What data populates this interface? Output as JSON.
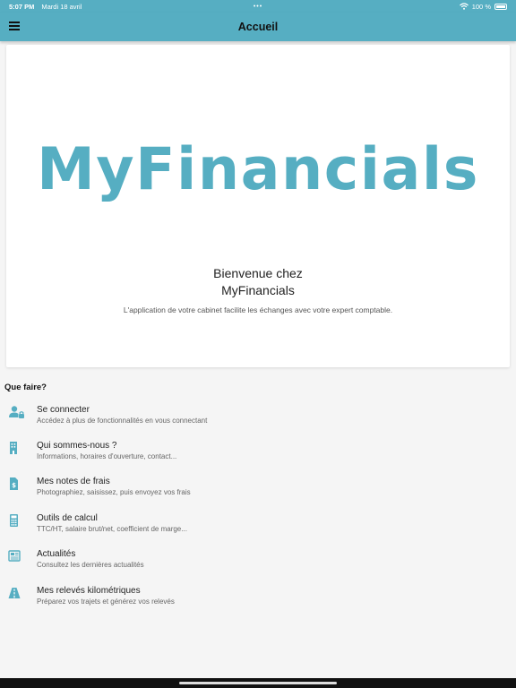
{
  "statusbar": {
    "time": "5:07 PM",
    "date": "Mardi 18 avril",
    "dots": "•••",
    "battery": "100 %"
  },
  "header": {
    "title": "Accueil"
  },
  "card": {
    "logo": "MyFinancials",
    "welcome_line1": "Bienvenue chez",
    "welcome_line2": "MyFinancials",
    "tagline": "L'application de votre cabinet facilite les échanges avec votre expert comptable."
  },
  "section": {
    "title": "Que faire?"
  },
  "items": [
    {
      "title": "Se connecter",
      "subtitle": "Accédez à plus de fonctionnalités en vous connectant",
      "icon": "user-lock-icon"
    },
    {
      "title": "Qui sommes-nous ?",
      "subtitle": "Informations, horaires d'ouverture, contact...",
      "icon": "building-icon"
    },
    {
      "title": "Mes notes de frais",
      "subtitle": "Photographiez, saisissez, puis envoyez vos frais",
      "icon": "receipt-icon"
    },
    {
      "title": "Outils de calcul",
      "subtitle": "TTC/HT, salaire brut/net, coefficient de marge...",
      "icon": "calculator-icon"
    },
    {
      "title": "Actualités",
      "subtitle": "Consultez les dernières actualités",
      "icon": "newspaper-icon"
    },
    {
      "title": "Mes relevés kilométriques",
      "subtitle": "Préparez vos trajets et générez vos relevés",
      "icon": "road-icon"
    }
  ],
  "colors": {
    "accent": "#56aec2",
    "background": "#f5f5f5"
  }
}
